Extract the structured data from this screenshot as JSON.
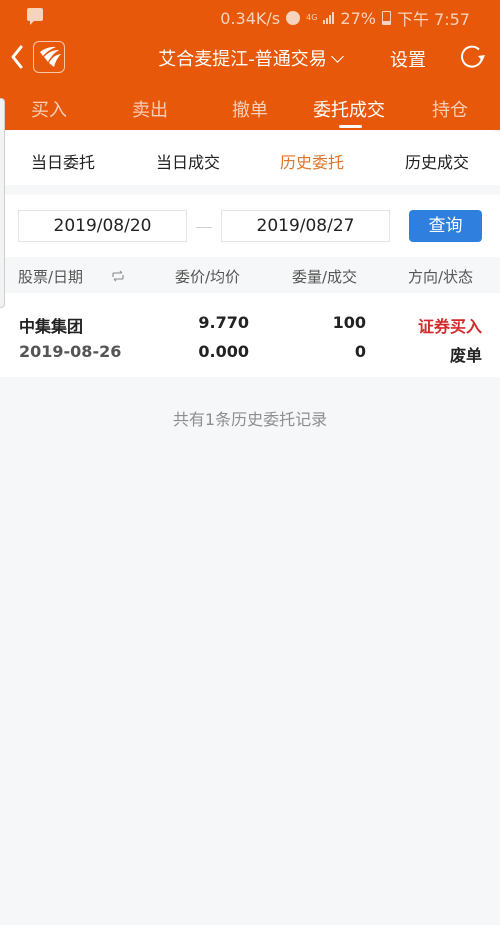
{
  "status_bar": {
    "network_speed": "0.34K/s",
    "network_type": "4G",
    "battery": "27%",
    "time": "下午 7:57"
  },
  "nav": {
    "title": "艾合麦提江-普通交易",
    "settings_label": "设置",
    "icons": {
      "back": "chevron-left-icon",
      "logo": "app-logo",
      "dropdown": "chevron-down-icon",
      "refresh": "refresh-icon"
    }
  },
  "main_tabs": [
    {
      "label": "买入",
      "active": false
    },
    {
      "label": "卖出",
      "active": false
    },
    {
      "label": "撤单",
      "active": false
    },
    {
      "label": "委托成交",
      "active": true
    },
    {
      "label": "持仓",
      "active": false
    }
  ],
  "sub_tabs": [
    {
      "label": "当日委托",
      "active": false
    },
    {
      "label": "当日成交",
      "active": false
    },
    {
      "label": "历史委托",
      "active": true
    },
    {
      "label": "历史成交",
      "active": false
    }
  ],
  "query": {
    "start_date": "2019/08/20",
    "end_date": "2019/08/27",
    "button_label": "查询"
  },
  "table": {
    "headers": [
      "股票/日期",
      "委价/均价",
      "委量/成交",
      "方向/状态"
    ],
    "rows": [
      {
        "stock": "中集集团",
        "date": "2019-08-26",
        "order_price": "9.770",
        "avg_price": "0.000",
        "order_qty": "100",
        "filled_qty": "0",
        "direction": "证券买入",
        "status": "废单"
      }
    ]
  },
  "summary": "共有1条历史委托记录",
  "colors": {
    "brand_orange": "#e8580a",
    "active_subtab": "#e0732a",
    "query_button": "#2f7fde",
    "buy_red": "#d42a2a"
  }
}
